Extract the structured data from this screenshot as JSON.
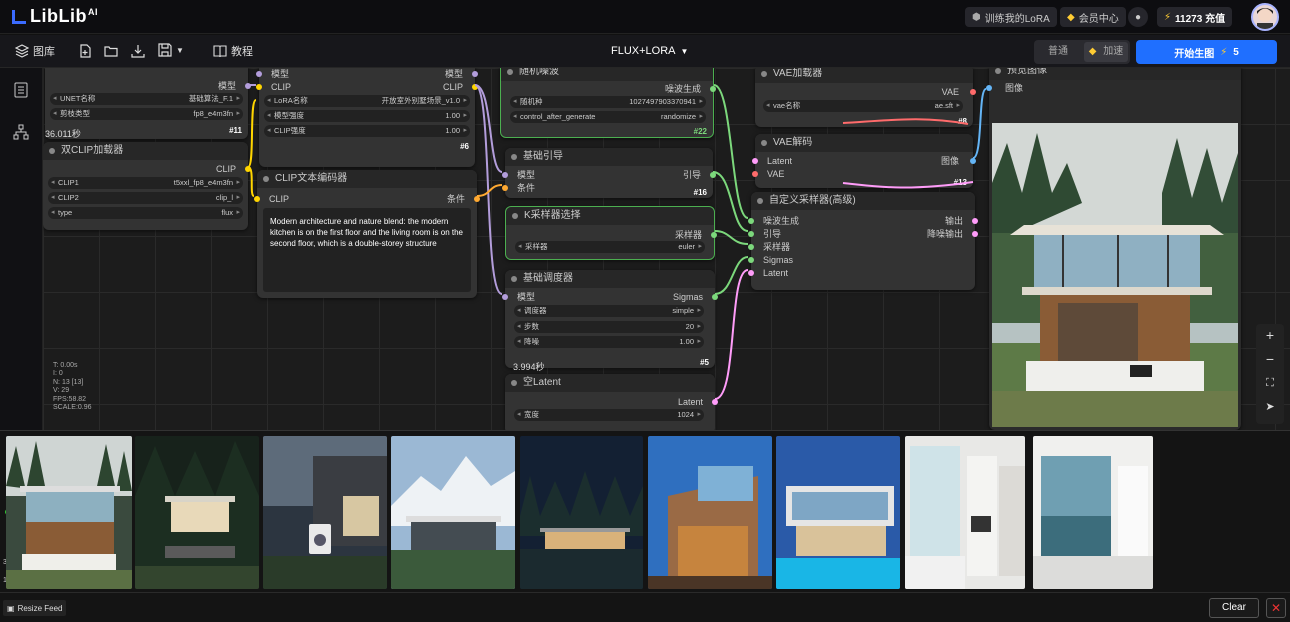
{
  "brand": {
    "name": "LibLib",
    "sup": "AI"
  },
  "topbar": {
    "train_lora": "训练我的LoRA",
    "member_center": "会员中心",
    "credits": "11273 充值"
  },
  "toolbar": {
    "gallery": "图库",
    "tutorial": "教程",
    "workflow_name": "FLUX+LORA",
    "mode_normal": "普通",
    "mode_fast": "加速",
    "generate": "开始生图",
    "generate_cost": "5"
  },
  "nodes": {
    "unet": {
      "title": "",
      "out_model": "模型",
      "w1_label": "UNET名称",
      "w1_value": "基础算法_F.1",
      "w2_label": "剪枝类型",
      "w2_value": "fp8_e4m3fn",
      "id": "#11",
      "timer": "36.011秒"
    },
    "dualclip": {
      "title": "双CLIP加载器",
      "out_clip": "CLIP",
      "w1_label": "CLIP1",
      "w1_value": "t5xxl_fp8_e4m3fn",
      "w2_label": "CLIP2",
      "w2_value": "clip_l",
      "w3_label": "type",
      "w3_value": "flux"
    },
    "lora": {
      "title": "",
      "in_model": "模型",
      "in_clip": "CLIP",
      "out_model": "模型",
      "out_clip": "CLIP",
      "w1_label": "LoRA名称",
      "w1_value": "开放室外别墅场景_v1.0",
      "w2_label": "模型强度",
      "w2_value": "1.00",
      "w3_label": "CLIP强度",
      "w3_value": "1.00",
      "id": "#6"
    },
    "clip_text": {
      "title": "CLIP文本编码器",
      "in_clip": "CLIP",
      "out_cond": "条件",
      "prompt": "Modern architecture and nature blend: the modern kitchen is on the first floor and the living room is on the second floor, which is a double-storey structure"
    },
    "noise": {
      "title": "随机噪波",
      "out": "噪波生成",
      "w1_label": "随机种",
      "w1_value": "1027497903370941",
      "w2_label": "control_after_generate",
      "w2_value": "randomize",
      "id": "#22"
    },
    "guider": {
      "title": "基础引导",
      "in_model": "模型",
      "in_cond": "条件",
      "out": "引导",
      "id": "#16"
    },
    "ksampler_select": {
      "title": "K采样器选择",
      "out": "采样器",
      "w1_label": "采样器",
      "w1_value": "euler"
    },
    "scheduler": {
      "title": "基础调度器",
      "in_model": "模型",
      "out": "Sigmas",
      "w1_label": "调度器",
      "w1_value": "simple",
      "w2_label": "步数",
      "w2_value": "20",
      "w3_label": "降噪",
      "w3_value": "1.00",
      "id": "#5",
      "timer": "3.994秒"
    },
    "empty_latent": {
      "title": "空Latent",
      "out": "Latent",
      "w1_label": "宽度",
      "w1_value": "1024"
    },
    "vae_loader": {
      "title": "VAE加载器",
      "out": "VAE",
      "w1_label": "vae名称",
      "w1_value": "ae.sft",
      "id": "#8"
    },
    "vae_decode": {
      "title": "VAE解码",
      "in_latent": "Latent",
      "in_vae": "VAE",
      "out": "图像",
      "id": "#13"
    },
    "custom_sampler": {
      "title": "自定义采样器(高级)",
      "in1": "噪波生成",
      "in2": "引导",
      "in3": "采样器",
      "in4": "Sigmas",
      "in5": "Latent",
      "out1": "输出",
      "out2": "降噪输出"
    },
    "preview": {
      "title": "预览图像",
      "in": "图像"
    }
  },
  "stats": [
    "T: 0.00s",
    "I: 0",
    "N: 13 [13]",
    "V: 29",
    "FPS:58.82",
    "SCALE:0.96"
  ],
  "feed": {
    "resize_label": "Resize Feed",
    "clear_label": "Clear",
    "side_values": [
      "3.7",
      "1.3"
    ]
  },
  "colors": {
    "accent": "#1f6fff",
    "model_wire": "#b39ddb",
    "clip_wire": "#ffd500",
    "cond_wire": "#ffa931",
    "latent_wire": "#ff9cf9",
    "image_wire": "#64b5f6",
    "green_wire": "#7cd87c"
  }
}
